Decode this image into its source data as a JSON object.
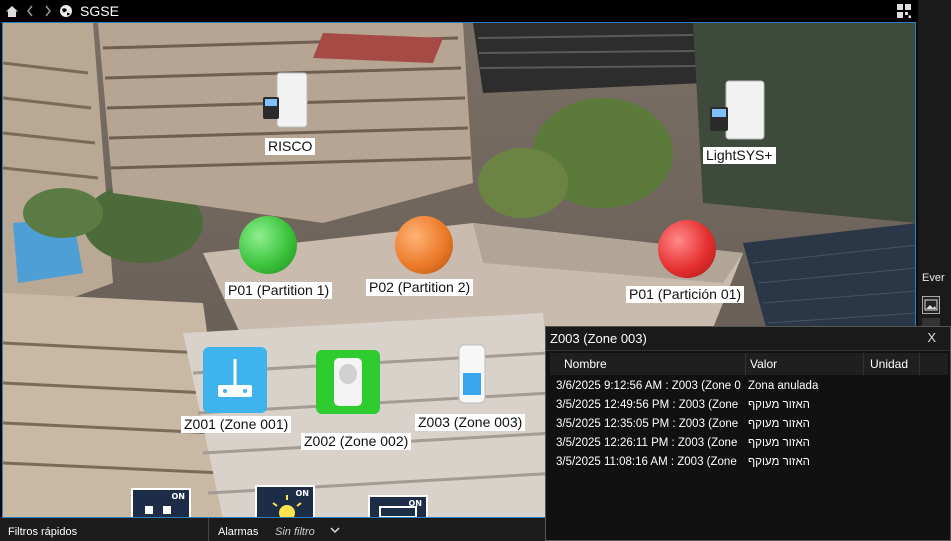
{
  "window": {
    "title": "SGSE",
    "nav_icons": [
      "home-icon",
      "back-icon",
      "forward-icon",
      "globe-icon"
    ],
    "grid_icon": "layout-grid-icon"
  },
  "map": {
    "panels": [
      {
        "name": "RISCO",
        "icon": "control-panel-icon"
      },
      {
        "name": "LightSYS+",
        "icon": "control-panel-icon"
      }
    ],
    "partitions": [
      {
        "name": "P01 (Partition 1)",
        "color": "#3cc43c"
      },
      {
        "name": "P02 (Partition 2)",
        "color": "#ec7b2a"
      },
      {
        "name": "P01 (Partición 01)",
        "color": "#e63030"
      }
    ],
    "zones": [
      {
        "name": "Z001 (Zone 001)",
        "icon": "sensor-icon",
        "color": "#3fb3ee"
      },
      {
        "name": "Z002 (Zone 002)",
        "icon": "pir-detector-icon",
        "color": "#2fcc2f"
      },
      {
        "name": "Z003 (Zone 003)",
        "icon": "pir-detector-icon",
        "color": "#ffffff"
      }
    ],
    "toggles": [
      {
        "label": "ON"
      },
      {
        "label": "ON"
      },
      {
        "label": "ON"
      }
    ]
  },
  "right_panel": {
    "label": "Ever"
  },
  "popup": {
    "title": "Z003 (Zone 003)",
    "close_label": "X",
    "columns": [
      "Nombre",
      "Valor",
      "Unidad"
    ],
    "rows": [
      {
        "nombre": "3/6/2025 9:12:56 AM : Z003 (Zone 0",
        "valor": "Zona anulada",
        "unidad": ""
      },
      {
        "nombre": "3/5/2025 12:49:56 PM : Z003 (Zone",
        "valor": "האזור מעוקף",
        "unidad": ""
      },
      {
        "nombre": "3/5/2025 12:35:05 PM : Z003 (Zone",
        "valor": "האזור מעוקף",
        "unidad": ""
      },
      {
        "nombre": "3/5/2025 12:26:11 PM : Z003 (Zone",
        "valor": "האזור מעוקף",
        "unidad": ""
      },
      {
        "nombre": "3/5/2025 11:08:16 AM : Z003 (Zone",
        "valor": "האזור מעוקף",
        "unidad": ""
      }
    ]
  },
  "statusbar": {
    "quick_filters": "Filtros rápidos",
    "alarms": "Alarmas",
    "filter": "Sin filtro"
  }
}
